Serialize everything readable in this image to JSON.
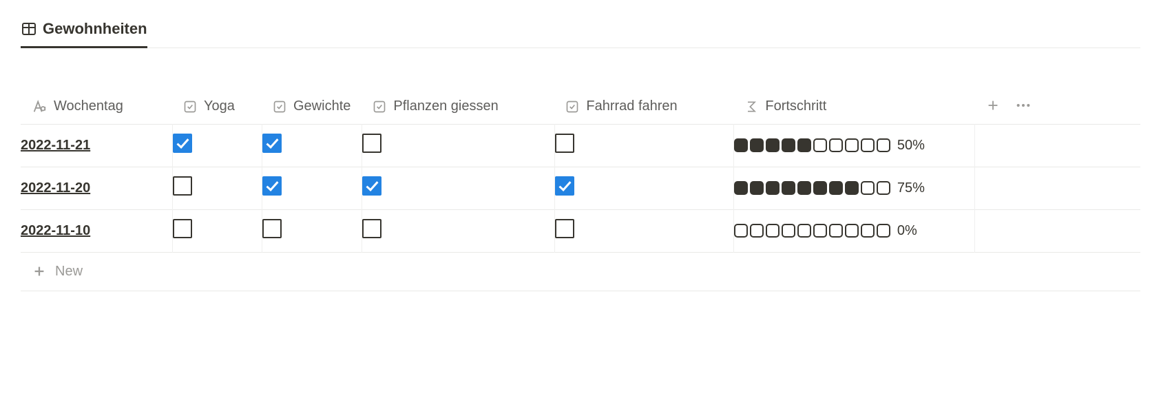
{
  "tab": {
    "label": "Gewohnheiten"
  },
  "columns": {
    "wochentag": "Wochentag",
    "yoga": "Yoga",
    "gewichte": "Gewichte",
    "pflanzen": "Pflanzen giessen",
    "fahrrad": "Fahrrad fahren",
    "fortschritt": "Fortschritt"
  },
  "rows": [
    {
      "title": "2022-11-21",
      "yoga": true,
      "gewichte": true,
      "pflanzen": false,
      "fahrrad": false,
      "progress_filled": 5,
      "progress_total": 10,
      "progress_label": "50%"
    },
    {
      "title": "2022-11-20",
      "yoga": false,
      "gewichte": true,
      "pflanzen": true,
      "fahrrad": true,
      "progress_filled": 8,
      "progress_total": 10,
      "progress_label": "75%"
    },
    {
      "title": "2022-11-10",
      "yoga": false,
      "gewichte": false,
      "pflanzen": false,
      "fahrrad": false,
      "progress_filled": 0,
      "progress_total": 10,
      "progress_label": "0%"
    }
  ],
  "new_row_label": "New",
  "accent_color": "#2383e2"
}
